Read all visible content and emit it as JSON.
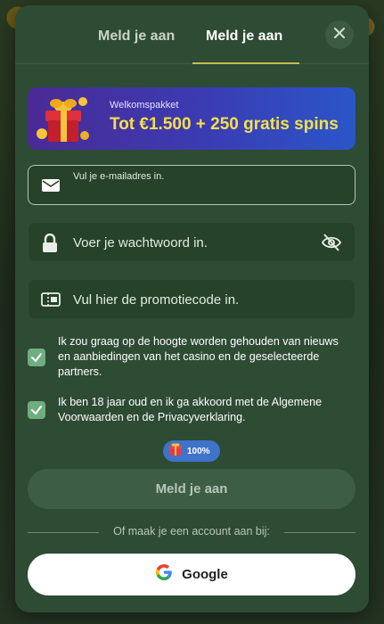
{
  "tabs": [
    {
      "label": "Meld je aan",
      "active": false
    },
    {
      "label": "Meld je aan",
      "active": true
    }
  ],
  "close_icon": "close-icon",
  "promo_banner": {
    "kicker": "Welkomspakket",
    "title": "Tot €1.500 + 250 gratis spins",
    "icon": "gift-box-icon"
  },
  "fields": {
    "email": {
      "placeholder": "Vul je e-mailadres in.",
      "icon": "envelope-icon",
      "value": ""
    },
    "password": {
      "placeholder": "Voer je wachtwoord in.",
      "icon": "lock-icon",
      "toggle_icon": "eye-off-icon",
      "value": ""
    },
    "promo": {
      "placeholder": "Vul hier de promotiecode in.",
      "icon": "ticket-icon",
      "value": ""
    }
  },
  "checkboxes": [
    {
      "label": "Ik zou graag op de hoogte worden gehouden van nieuws en aanbiedingen van het casino en de geselecteerde partners.",
      "checked": true
    },
    {
      "label": "Ik ben 18 jaar oud en ik ga akkoord met de Algemene Voorwaarden en de Privacyverklaring.",
      "checked": true
    }
  ],
  "bonus_badge": {
    "text": "100%",
    "icon": "gift-icon"
  },
  "submit": {
    "label": "Meld je aan"
  },
  "alt_divider": {
    "text": "Of maak je een account aan bij:"
  },
  "google": {
    "label": "Google",
    "icon": "google-icon"
  },
  "colors": {
    "modal_bg": "#2e4b34",
    "field_bg": "#264229",
    "accent_underline": "#c5bd4e",
    "checkbox": "#6fae7f",
    "banner_title": "#f4e04a",
    "badge": "#3e73c9"
  }
}
